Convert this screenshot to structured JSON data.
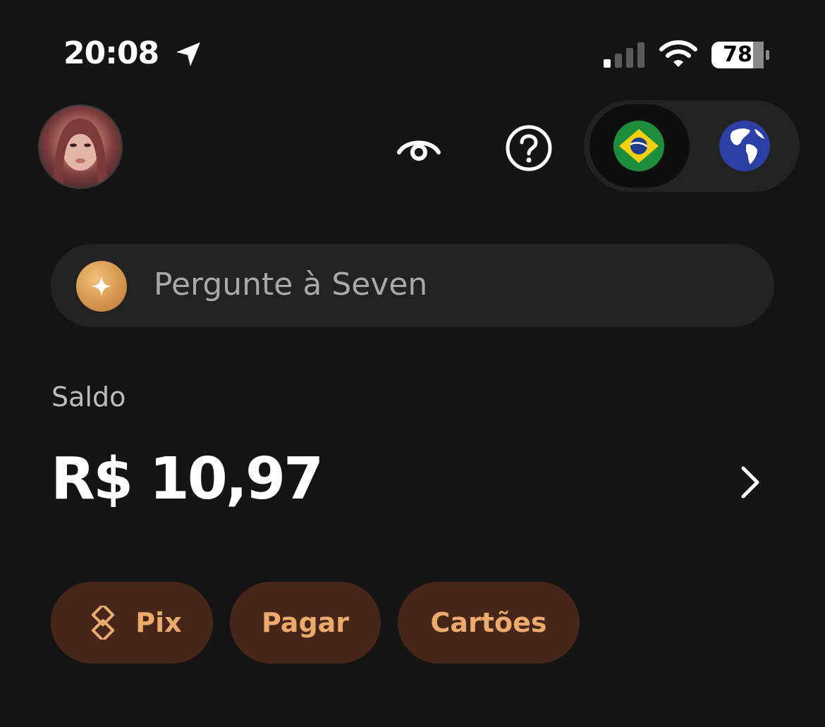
{
  "status_bar": {
    "time": "20:08",
    "battery": "78",
    "icons": [
      "location-arrow-icon",
      "cellular-signal-icon",
      "wifi-icon",
      "battery-icon"
    ]
  },
  "header": {
    "icons": [
      "avatar",
      "eye-icon",
      "help-icon",
      "brazil-flag-icon",
      "globe-icon"
    ],
    "active_region": "brazil"
  },
  "search": {
    "placeholder": "Pergunte à Seven",
    "icon": "sparkle-icon"
  },
  "balance": {
    "label": "Saldo",
    "amount": "R$ 10,97",
    "icon": "chevron-right-icon"
  },
  "actions": [
    {
      "label": "Pix",
      "icon": "pix-icon"
    },
    {
      "label": "Pagar"
    },
    {
      "label": "Cartões"
    }
  ],
  "colors": {
    "background": "#141414",
    "surface": "#222222",
    "pill_bg": "#47261a",
    "pill_text": "#ecaa6c",
    "accent_gold": "#d5964e"
  }
}
